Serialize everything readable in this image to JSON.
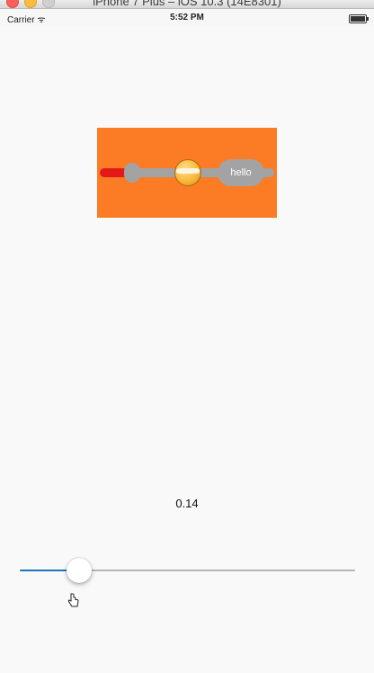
{
  "window": {
    "title": "iPhone 7 Plus – iOS 10.3 (14E8301)"
  },
  "status_bar": {
    "carrier": "Carrier ᯤ",
    "time": "5:52 PM"
  },
  "custom_slider": {
    "bubble_text": "hello",
    "value": 0.5,
    "colors": {
      "background": "#fc7b25",
      "track": "#a3a3a3",
      "min_track": "#e51818"
    }
  },
  "value_label": "0.14",
  "standard_slider": {
    "value": 0.15,
    "colors": {
      "min_track": "#1c75bf",
      "max_track": "#b6b6b6"
    }
  }
}
